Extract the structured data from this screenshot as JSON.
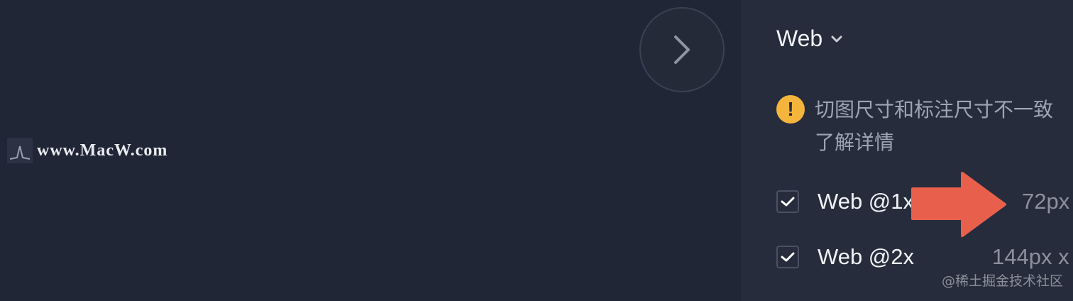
{
  "watermark": {
    "text": "www.MacW.com"
  },
  "panel": {
    "platform": {
      "label": "Web",
      "icon": "chevron-down-icon"
    },
    "notice": {
      "icon": "warning-icon",
      "text": "切图尺寸和标注尺寸不一致",
      "link": "了解详情",
      "color": "#f5b53d"
    },
    "export_options": [
      {
        "label": "Web @1x",
        "size": "72px",
        "checked": true
      },
      {
        "label": "Web @2x",
        "size": "144px x",
        "checked": true
      }
    ]
  },
  "annotation": {
    "type": "arrow",
    "color": "#e8604c"
  },
  "footer": {
    "source": "@稀土掘金技术社区"
  }
}
